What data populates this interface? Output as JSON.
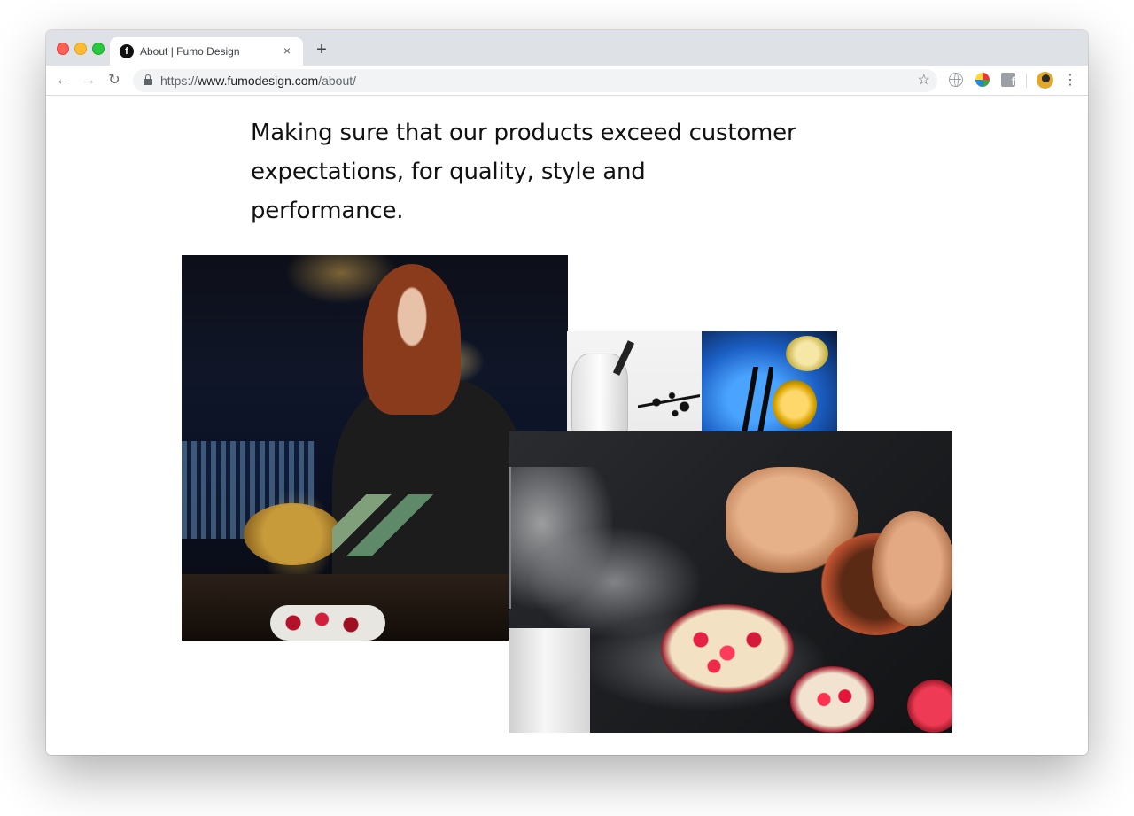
{
  "browser": {
    "tab": {
      "favicon_letter": "f",
      "title": "About | Fumo Design",
      "close_glyph": "×"
    },
    "new_tab_glyph": "+",
    "nav": {
      "back_glyph": "←",
      "forward_glyph": "→",
      "reload_glyph": "↻"
    },
    "address": {
      "scheme": "https://",
      "host": "www.fumodesign.com",
      "path": "/about/"
    },
    "bookmark_glyph": "☆",
    "extensions": [
      "globe-icon",
      "colorful-extension-icon",
      "facebook-icon"
    ],
    "menu_glyph": "⋮"
  },
  "page": {
    "headline": "Making sure that our products exceed customer expectations, for quality, style and performance."
  }
}
